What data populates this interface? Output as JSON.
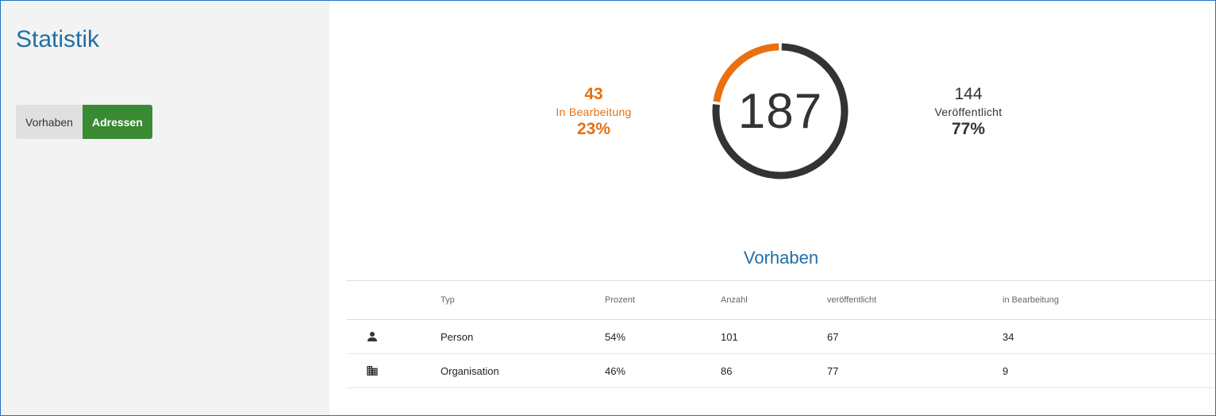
{
  "sidebar": {
    "title": "Statistik",
    "toggle": {
      "vorhaben_label": "Vorhaben",
      "adressen_label": "Adressen",
      "active": "Adressen"
    }
  },
  "summary": {
    "total": "187",
    "in_bearbeitung": {
      "count": "43",
      "label": "In Bearbeitung",
      "percent": "23%",
      "fraction": 0.23
    },
    "veroeffentlicht": {
      "count": "144",
      "label": "Veröffentlicht",
      "percent": "77%",
      "fraction": 0.77
    }
  },
  "colors": {
    "accent_orange": "#e8700f",
    "published_dark": "#333333",
    "title_blue": "#1f6fa6",
    "active_green": "#3a8a34"
  },
  "table": {
    "title": "Vorhaben",
    "headers": {
      "icon": "",
      "typ": "Typ",
      "prozent": "Prozent",
      "anzahl": "Anzahl",
      "veroeffentlicht": "veröffentlicht",
      "in_bearbeitung": "in Bearbeitung"
    },
    "rows": [
      {
        "icon": "person-icon",
        "typ": "Person",
        "prozent": "54%",
        "anzahl": "101",
        "veroeffentlicht": "67",
        "in_bearbeitung": "34"
      },
      {
        "icon": "building-icon",
        "typ": "Organisation",
        "prozent": "46%",
        "anzahl": "86",
        "veroeffentlicht": "77",
        "in_bearbeitung": "9"
      }
    ]
  }
}
